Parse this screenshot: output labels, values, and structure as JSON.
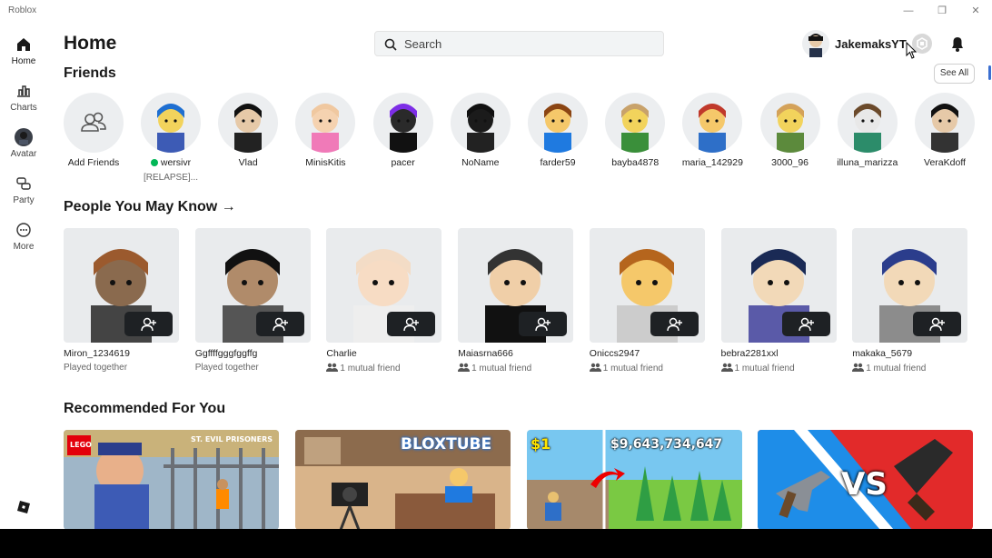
{
  "window": {
    "title": "Roblox"
  },
  "sidebar": {
    "items": [
      {
        "label": "Home",
        "icon": "home-icon"
      },
      {
        "label": "Charts",
        "icon": "charts-icon"
      },
      {
        "label": "Avatar",
        "icon": "avatar-icon"
      },
      {
        "label": "Party",
        "icon": "party-icon"
      },
      {
        "label": "More",
        "icon": "more-icon"
      }
    ]
  },
  "header": {
    "title": "Home",
    "search_placeholder": "Search",
    "username": "JakemaksYT"
  },
  "friends": {
    "title": "Friends",
    "see_all": "See All",
    "add_label": "Add Friends",
    "items": [
      {
        "name": "wersivr",
        "status": "[RELAPSE]...",
        "online": true
      },
      {
        "name": "Vlad"
      },
      {
        "name": "MinisKitis"
      },
      {
        "name": "pacer"
      },
      {
        "name": "NoName"
      },
      {
        "name": "farder59"
      },
      {
        "name": "bayba4878"
      },
      {
        "name": "maria_142929"
      },
      {
        "name": "3000_96"
      },
      {
        "name": "illuna_marizza"
      },
      {
        "name": "VeraKdoff"
      }
    ]
  },
  "people": {
    "title": "People You May Know",
    "arrow": "→",
    "items": [
      {
        "name": "Miron_1234619",
        "sub": "Played together",
        "mutual": false
      },
      {
        "name": "Ggffffgggfggffg",
        "sub": "Played together",
        "mutual": false
      },
      {
        "name": "Charlie",
        "sub": "1 mutual friend",
        "mutual": true
      },
      {
        "name": "Maiasrna666",
        "sub": "1 mutual friend",
        "mutual": true
      },
      {
        "name": "Oniccs2947",
        "sub": "1 mutual friend",
        "mutual": true
      },
      {
        "name": "bebra2281xxl",
        "sub": "1 mutual friend",
        "mutual": true
      },
      {
        "name": "makaka_5679",
        "sub": "1 mutual friend",
        "mutual": true
      }
    ]
  },
  "recommended": {
    "title": "Recommended For You",
    "games": [
      {
        "art_text": "LEGO",
        "caption": "ST. EVIL PRISONERS"
      },
      {
        "art_text": "BLOXTUBE"
      },
      {
        "art_text": "$1",
        "art_text2": "$9,643,734,647"
      },
      {
        "art_text": "VS"
      }
    ]
  },
  "colors": {
    "accent": "#3b6fd1",
    "online": "#02b757",
    "dark_button": "#1e2124",
    "tile_bg": "#e9ebed"
  }
}
